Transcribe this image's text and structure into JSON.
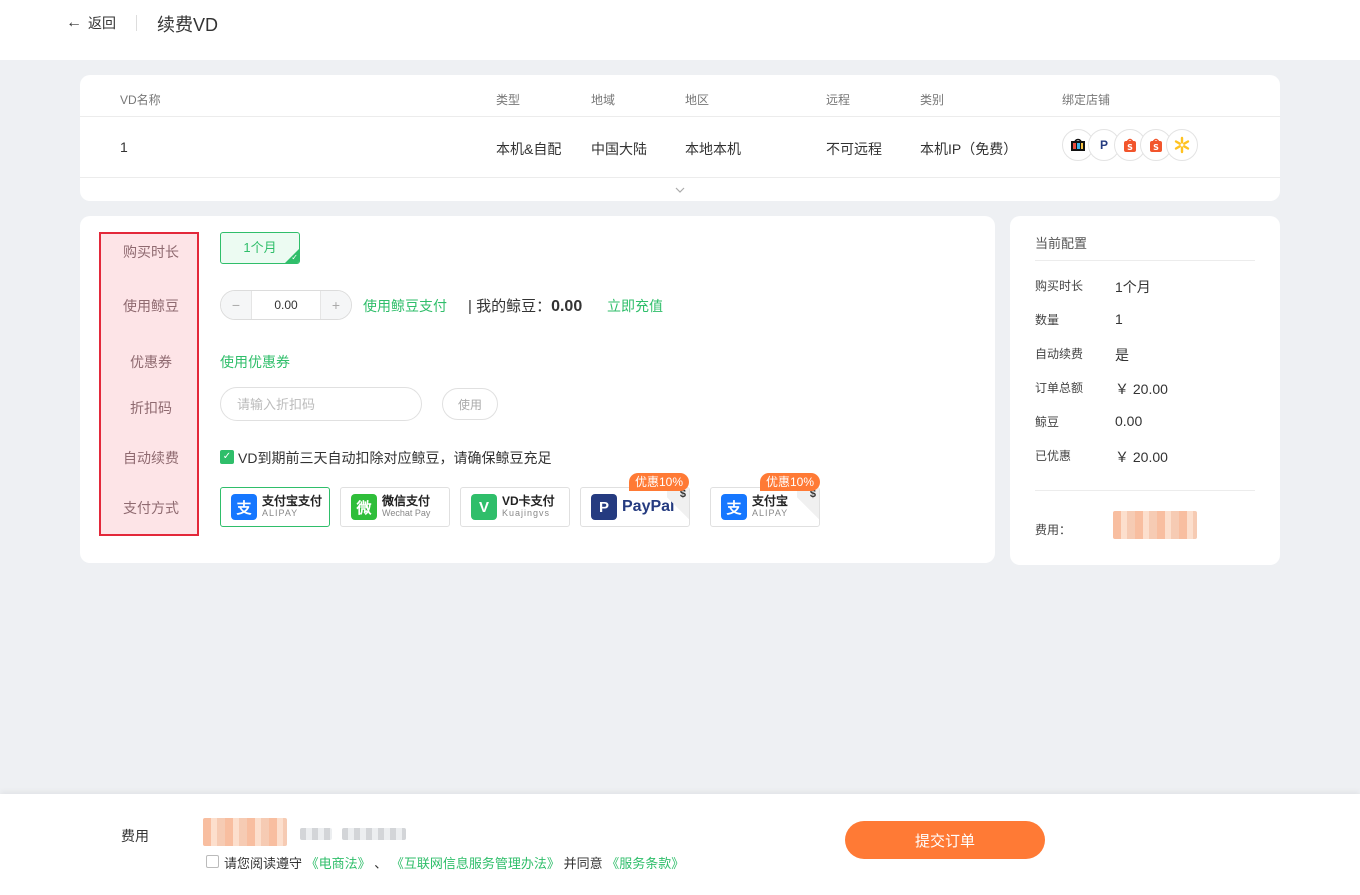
{
  "header": {
    "back_label": "返回",
    "title": "续费VD"
  },
  "vd_table": {
    "columns": [
      "VD名称",
      "类型",
      "地域",
      "地区",
      "远程",
      "类别",
      "绑定店铺"
    ],
    "row": {
      "name": "1",
      "type": "本机&自配",
      "region": "中国大陆",
      "area": "本地本机",
      "remote": "不可远程",
      "category": "本机IP（免费）"
    },
    "shop_icons": [
      "tiktok-shop-icon",
      "paypal-icon",
      "shopee-icon",
      "shopee-icon",
      "walmart-icon"
    ]
  },
  "form": {
    "labels": {
      "duration": "购买时长",
      "beans": "使用鲸豆",
      "coupon": "优惠券",
      "discount": "折扣码",
      "auto_renew": "自动续费",
      "payment": "支付方式"
    },
    "duration_option": "1个月",
    "stepper": {
      "minus": "−",
      "value": "0.00",
      "plus": "+"
    },
    "use_bean_pay": "使用鲸豆支付",
    "my_beans_label": "| 我的鲸豆：",
    "my_beans_value": "0.00",
    "recharge": "立即充值",
    "use_coupon": "使用优惠券",
    "discount_placeholder": "请输入折扣码",
    "use_button": "使用",
    "auto_renew_text": "VD到期前三天自动扣除对应鲸豆，请确保鲸豆充足",
    "payments": [
      {
        "main": "支付宝支付",
        "sub": "ALIPAY",
        "logo": "支",
        "color": "#1677ff"
      },
      {
        "main": "微信支付",
        "sub": "Wechat Pay",
        "logo": "微",
        "color": "#2fbe3a"
      },
      {
        "main": "VD卡支付",
        "sub": "Kuajingvs",
        "logo": "V",
        "color": "#2fbe6a"
      },
      {
        "main": "PayPal",
        "logo": "P",
        "color": "#253b80",
        "promo": "优惠10%"
      },
      {
        "main": "支付宝",
        "sub": "ALIPAY",
        "logo": "支",
        "color": "#1677ff",
        "promo": "优惠10%"
      }
    ],
    "dollar": "$"
  },
  "summary": {
    "title": "当前配置",
    "rows": [
      {
        "key": "购买时长",
        "value": "1个月"
      },
      {
        "key": "数量",
        "value": "1"
      },
      {
        "key": "自动续费",
        "value": "是"
      },
      {
        "key": "订单总额",
        "value": "￥ 20.00"
      },
      {
        "key": "鲸豆",
        "value": "0.00"
      },
      {
        "key": "已优惠",
        "value": "￥ 20.00"
      }
    ],
    "fee_label": "费用："
  },
  "footer": {
    "fee_label": "费用",
    "agree_prefix": "请您阅读遵守",
    "law1": "《电商法》",
    "sep": "、",
    "law2": "《互联网信息服务管理办法》",
    "agree_mid": "并同意",
    "terms": "《服务条款》",
    "submit": "提交订单"
  }
}
